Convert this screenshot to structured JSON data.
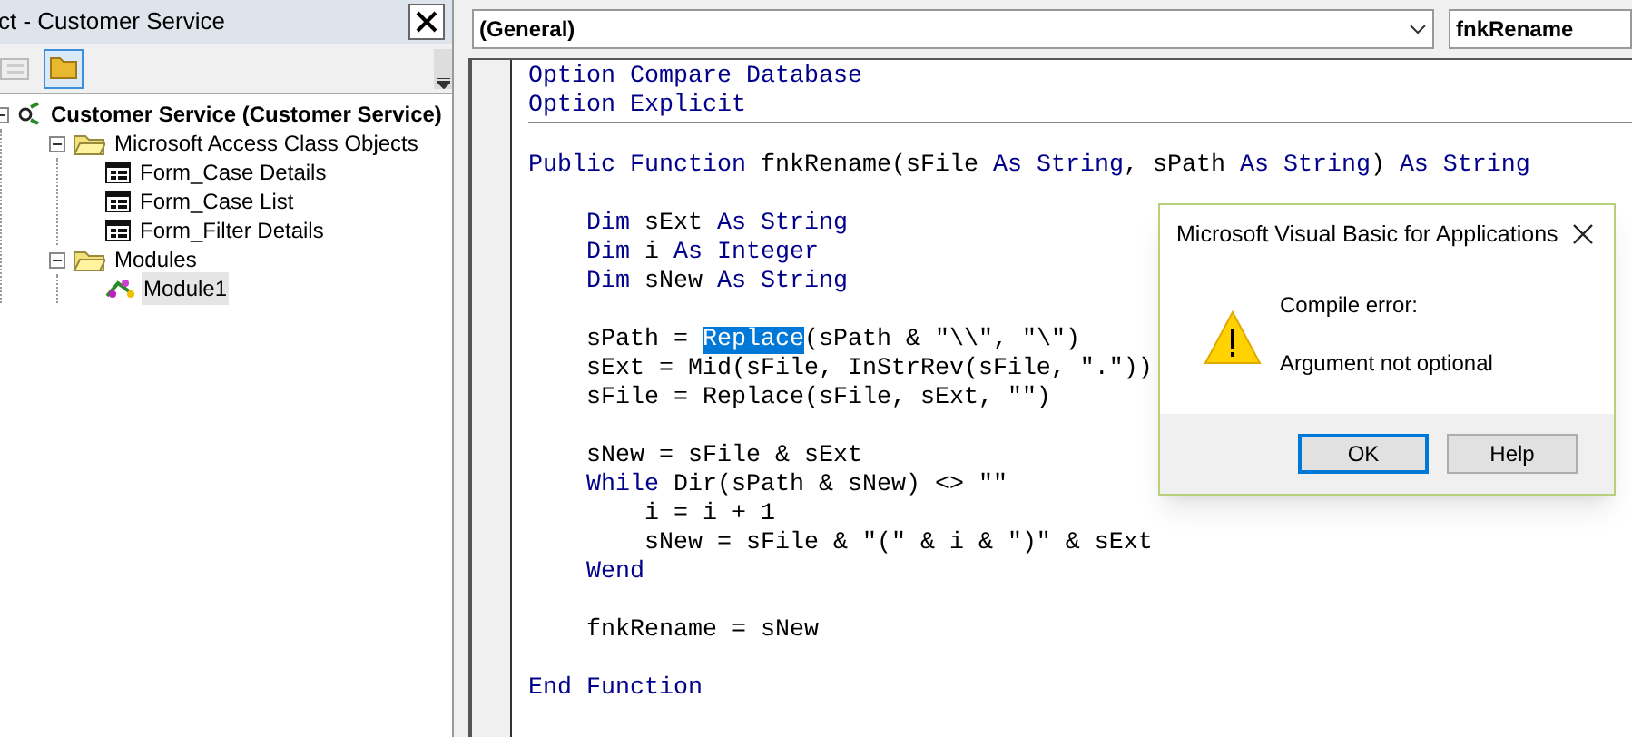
{
  "project_pane": {
    "title": "ct - Customer Service",
    "tree": [
      {
        "label": "Customer Service (Customer Service)",
        "kind": "project",
        "expanded": true,
        "selected": false,
        "children": [
          {
            "label": "Microsoft Access Class Objects",
            "kind": "folder",
            "expanded": true,
            "selected": false,
            "children": [
              {
                "label": "Form_Case Details",
                "kind": "form",
                "selected": false
              },
              {
                "label": "Form_Case List",
                "kind": "form",
                "selected": false
              },
              {
                "label": "Form_Filter Details",
                "kind": "form",
                "selected": false
              }
            ]
          },
          {
            "label": "Modules",
            "kind": "folder",
            "expanded": true,
            "selected": false,
            "children": [
              {
                "label": "Module1",
                "kind": "module",
                "selected": true
              }
            ]
          }
        ]
      }
    ]
  },
  "code_window": {
    "object_combo": "(General)",
    "procedure_combo": "fnkRename",
    "sections": [
      {
        "lines": [
          {
            "kind": "code",
            "tokens": [
              {
                "text": "Option Compare Database",
                "kind": "keyword"
              }
            ]
          },
          {
            "kind": "code",
            "tokens": [
              {
                "text": "Option Explicit",
                "kind": "keyword"
              }
            ]
          }
        ]
      },
      {
        "lines": [
          {
            "kind": "blank"
          },
          {
            "kind": "code",
            "tokens": [
              {
                "text": "Public Function",
                "kind": "keyword"
              },
              {
                "text": " fnkRename(sFile ",
                "kind": "plain"
              },
              {
                "text": "As String",
                "kind": "keyword"
              },
              {
                "text": ", sPath ",
                "kind": "plain"
              },
              {
                "text": "As String",
                "kind": "keyword"
              },
              {
                "text": ") ",
                "kind": "plain"
              },
              {
                "text": "As String",
                "kind": "keyword"
              }
            ]
          },
          {
            "kind": "blank"
          },
          {
            "kind": "code",
            "tokens": [
              {
                "text": "    Dim",
                "kind": "keyword"
              },
              {
                "text": " sExt ",
                "kind": "plain"
              },
              {
                "text": "As String",
                "kind": "keyword"
              }
            ]
          },
          {
            "kind": "code",
            "tokens": [
              {
                "text": "    Dim",
                "kind": "keyword"
              },
              {
                "text": " i ",
                "kind": "plain"
              },
              {
                "text": "As Integer",
                "kind": "keyword"
              }
            ]
          },
          {
            "kind": "code",
            "tokens": [
              {
                "text": "    Dim",
                "kind": "keyword"
              },
              {
                "text": " sNew ",
                "kind": "plain"
              },
              {
                "text": "As String",
                "kind": "keyword"
              }
            ]
          },
          {
            "kind": "blank"
          },
          {
            "kind": "code",
            "tokens": [
              {
                "text": "    sPath = ",
                "kind": "plain"
              },
              {
                "text": "Replace",
                "kind": "selected"
              },
              {
                "text": "(sPath & \"\\\\\", \"\\\")",
                "kind": "plain"
              }
            ]
          },
          {
            "kind": "code",
            "tokens": [
              {
                "text": "    sExt = Mid(sFile, InStrRev(sFile, \".\"))",
                "kind": "plain"
              }
            ]
          },
          {
            "kind": "code",
            "tokens": [
              {
                "text": "    sFile = Replace(sFile, sExt, \"\")",
                "kind": "plain"
              }
            ]
          },
          {
            "kind": "blank"
          },
          {
            "kind": "code",
            "tokens": [
              {
                "text": "    sNew = sFile & sExt",
                "kind": "plain"
              }
            ]
          },
          {
            "kind": "code",
            "tokens": [
              {
                "text": "    While",
                "kind": "keyword"
              },
              {
                "text": " Dir(sPath & sNew) <> \"\"",
                "kind": "plain"
              }
            ]
          },
          {
            "kind": "code",
            "tokens": [
              {
                "text": "        i = i + 1",
                "kind": "plain"
              }
            ]
          },
          {
            "kind": "code",
            "tokens": [
              {
                "text": "        sNew = sFile & \"(\" & i & \")\" & sExt",
                "kind": "plain"
              }
            ]
          },
          {
            "kind": "code",
            "tokens": [
              {
                "text": "    Wend",
                "kind": "keyword"
              }
            ]
          },
          {
            "kind": "blank"
          },
          {
            "kind": "code",
            "tokens": [
              {
                "text": "    fnkRename = sNew",
                "kind": "plain"
              }
            ]
          },
          {
            "kind": "blank"
          },
          {
            "kind": "code",
            "tokens": [
              {
                "text": "End Function",
                "kind": "keyword"
              }
            ]
          }
        ]
      }
    ]
  },
  "dialog": {
    "title": "Microsoft Visual Basic for Applications",
    "heading": "Compile error:",
    "message": "Argument not optional",
    "buttons": [
      {
        "label": "OK",
        "selected": true
      },
      {
        "label": "Help",
        "selected": false
      }
    ]
  }
}
